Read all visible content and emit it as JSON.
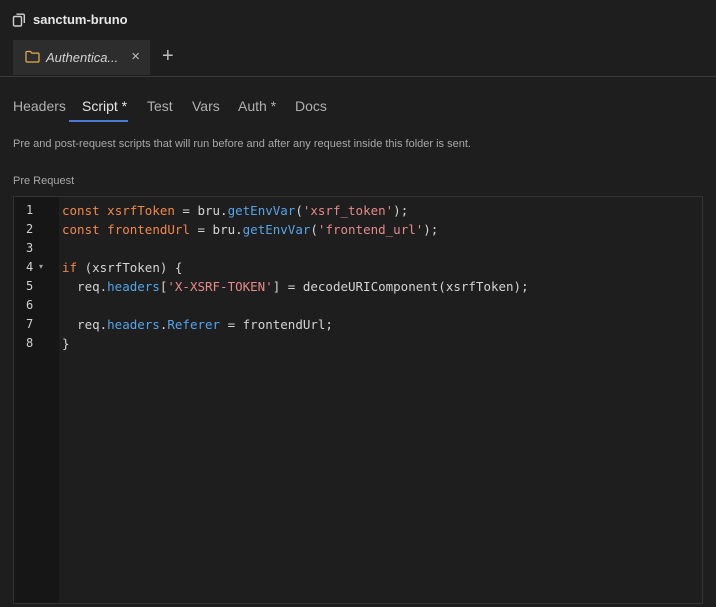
{
  "titlebar": {
    "title": "sanctum-bruno",
    "icon": "copy-icon"
  },
  "tabs": [
    {
      "label": "Authentica...",
      "icon": "folder-icon",
      "active": true
    }
  ],
  "add_tab_label": "+",
  "close_label": "×",
  "subtabs": [
    {
      "label": "Headers",
      "active": false
    },
    {
      "label": "Script *",
      "active": true
    },
    {
      "label": "Test",
      "active": false
    },
    {
      "label": "Vars",
      "active": false
    },
    {
      "label": "Auth *",
      "active": false
    },
    {
      "label": "Docs",
      "active": false
    }
  ],
  "description": "Pre and post-request scripts that will run before and after any request inside this folder is sent.",
  "section_label": "Pre Request",
  "editor": {
    "line_numbers": [
      "1",
      "2",
      "3",
      "4",
      "5",
      "6",
      "7",
      "8"
    ],
    "lines": [
      "const xsrfToken = bru.getEnvVar('xsrf_token');",
      "const frontendUrl = bru.getEnvVar('frontend_url');",
      "",
      "if (xsrfToken) {",
      "  req.headers['X-XSRF-TOKEN'] = decodeURIComponent(xsrfToken);",
      "",
      "  req.headers.Referer = frontendUrl;",
      "}"
    ]
  },
  "colors": {
    "accent": "#4a7ad8",
    "keyword": "#f0884a",
    "function": "#56a4e8",
    "string": "#e58a8a",
    "folder": "#e8b04a"
  }
}
